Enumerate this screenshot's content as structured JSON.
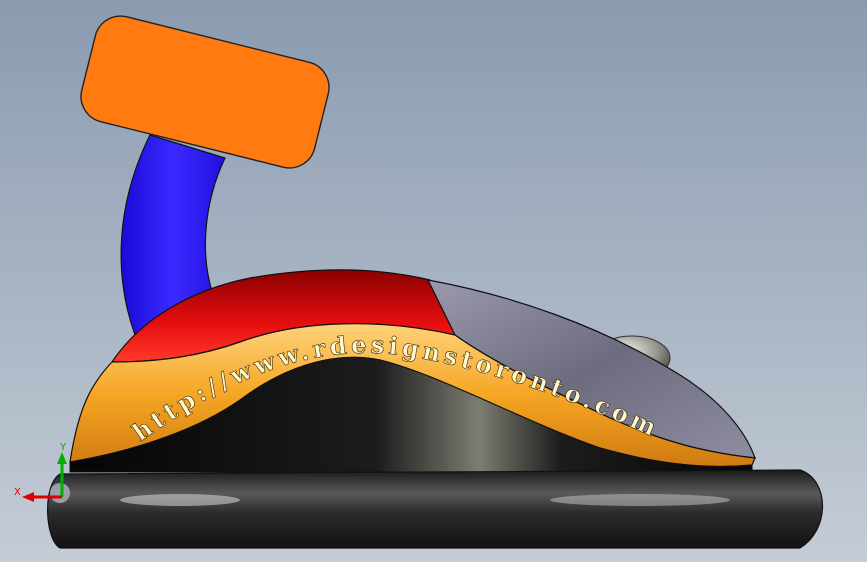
{
  "viewport": {
    "background_top": "#8a9bb0",
    "background_bottom": "#c4ccd6"
  },
  "model": {
    "engraved_text": "http://www.rdesignstoronto.com",
    "colors": {
      "handle_pad": "#ff7a10",
      "handle_arm": "#2a1aff",
      "shell_top": "#e80f0f",
      "shell_band": "#f5a623",
      "shell_body": "#111111",
      "button_panel": "#7a7a8c",
      "base": "#2b2b2b"
    }
  },
  "triad": {
    "x_label": "X",
    "y_label": "Y",
    "x_color": "#e00000",
    "y_color": "#00b000"
  }
}
